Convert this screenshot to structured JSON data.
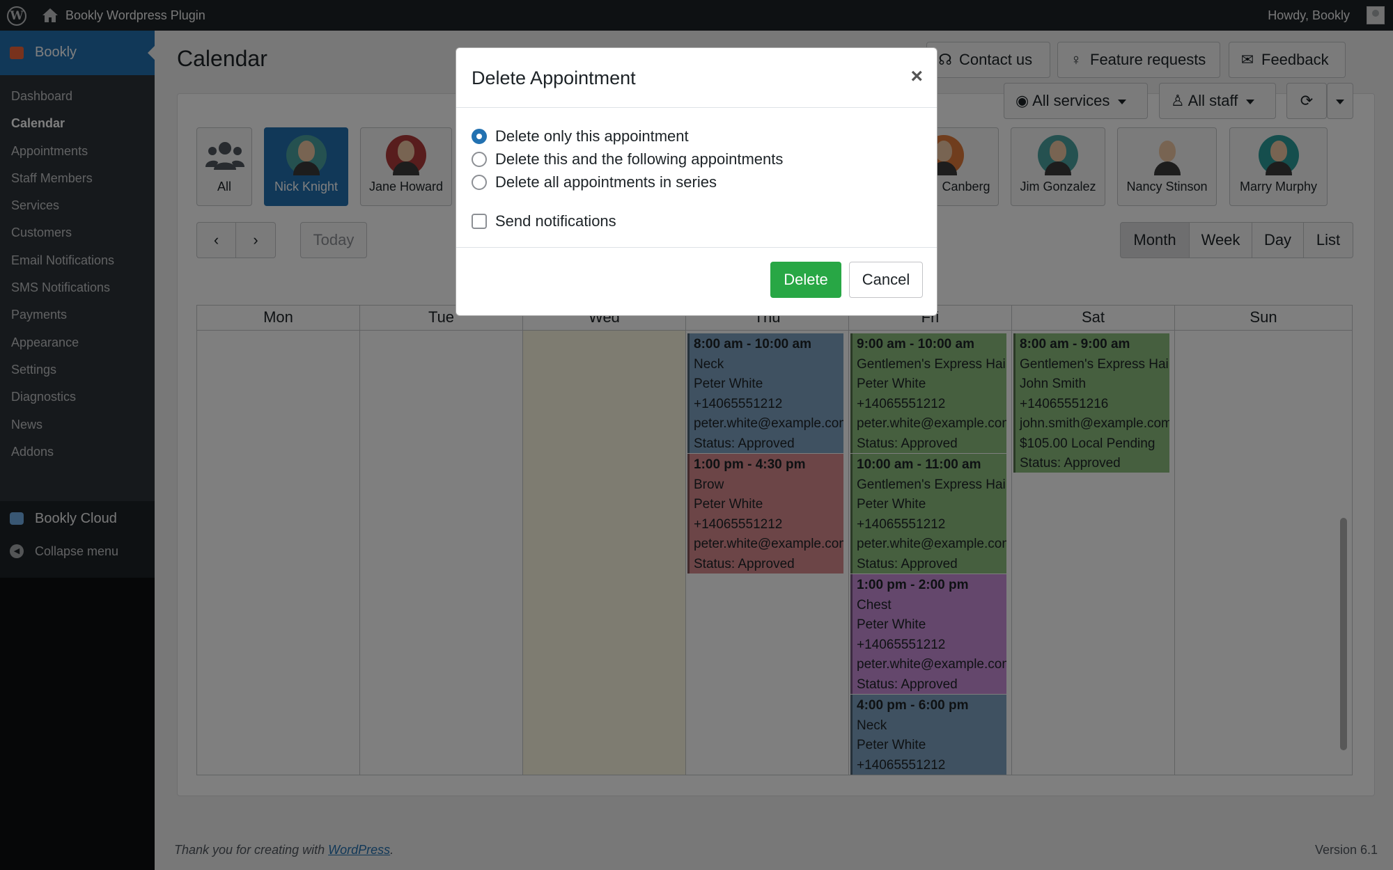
{
  "adminbar": {
    "site_name": "Bookly Wordpress Plugin",
    "howdy": "Howdy, Bookly"
  },
  "sidebar": {
    "top_item": "Bookly",
    "items": [
      "Dashboard",
      "Calendar",
      "Appointments",
      "Staff Members",
      "Services",
      "Customers",
      "Email Notifications",
      "SMS Notifications",
      "Payments",
      "Appearance",
      "Settings",
      "Diagnostics",
      "News",
      "Addons"
    ],
    "current": "Calendar",
    "cloud": "Bookly Cloud",
    "collapse": "Collapse menu"
  },
  "page": {
    "title": "Calendar",
    "top_buttons": {
      "contact": "Contact us",
      "feature": "Feature requests",
      "feedback": "Feedback"
    },
    "filters": {
      "services": "All services",
      "staff": "All staff"
    },
    "staff": [
      {
        "name": "All",
        "active": false
      },
      {
        "name": "Nick Knight",
        "active": true
      },
      {
        "name": "Jane Howard",
        "active": false
      },
      {
        "name": "Canberg",
        "active": false
      },
      {
        "name": "Jim Gonzalez",
        "active": false
      },
      {
        "name": "Nancy Stinson",
        "active": false
      },
      {
        "name": "Marry Murphy",
        "active": false
      }
    ],
    "nav": {
      "today": "Today"
    },
    "views": {
      "month": "Month",
      "week": "Week",
      "day": "Day",
      "list": "List",
      "active": "Month"
    },
    "days": [
      "Mon",
      "Tue",
      "Wed",
      "Thu",
      "Fri",
      "Sat",
      "Sun"
    ]
  },
  "events": {
    "thu": [
      {
        "time": "8:00 am - 10:00 am",
        "service": "Neck",
        "client": "Peter White",
        "phone": "+14065551212",
        "email": "peter.white@example.com",
        "status": "Status: Approved",
        "color": "#7fa3c3"
      },
      {
        "time": "1:00 pm - 4:30 pm",
        "service": "Brow",
        "client": "Peter White",
        "phone": "+14065551212",
        "email": "peter.white@example.com",
        "status": "Status: Approved",
        "color": "#d98b8f"
      }
    ],
    "fri": [
      {
        "time": "9:00 am - 10:00 am",
        "service": "Gentlemen's Express Haircut",
        "client": "Peter White",
        "phone": "+14065551212",
        "email": "peter.white@example.com",
        "status": "Status: Approved",
        "color": "#8dbf7f"
      },
      {
        "time": "10:00 am - 11:00 am",
        "service": "Gentlemen's Express Haircut",
        "client": "Peter White",
        "phone": "+14065551212",
        "email": "peter.white@example.com",
        "status": "Status: Approved",
        "color": "#8dbf7f"
      },
      {
        "time": "1:00 pm - 2:00 pm",
        "service": "Chest",
        "client": "Peter White",
        "phone": "+14065551212",
        "email": "peter.white@example.com",
        "status": "Status: Approved",
        "color": "#c88fd9"
      },
      {
        "time": "4:00 pm - 6:00 pm",
        "service": "Neck",
        "client": "Peter White",
        "phone": "+14065551212",
        "color": "#7fa3c3"
      }
    ],
    "sat": [
      {
        "time": "8:00 am - 9:00 am",
        "service": "Gentlemen's Express Haircut",
        "client": "John Smith",
        "phone": "+14065551216",
        "email": "john.smith@example.com",
        "payment": "$105.00 Local Pending",
        "status": "Status: Approved",
        "color": "#8dbf7f"
      }
    ]
  },
  "modal": {
    "title": "Delete Appointment",
    "options": [
      "Delete only this appointment",
      "Delete this and the following appointments",
      "Delete all appointments in series"
    ],
    "selected": 0,
    "notify": "Send notifications",
    "delete": "Delete",
    "cancel": "Cancel"
  },
  "footer": {
    "text": "Thank you for creating with",
    "link": "WordPress",
    "version": "Version 6.1"
  }
}
